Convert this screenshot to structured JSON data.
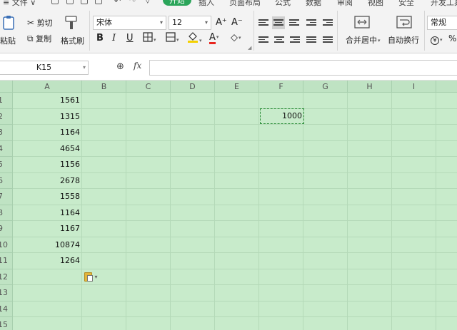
{
  "menu": {
    "file": "≡ 文件",
    "file_arrow": "∨",
    "tabs": [
      "开始",
      "插入",
      "页面布局",
      "公式",
      "数据",
      "审阅",
      "视图",
      "安全",
      "开发工具"
    ],
    "active_tab": "开始"
  },
  "ribbon": {
    "paste": "粘贴",
    "cut": "剪切",
    "copy": "复制",
    "format_painter": "格式刷",
    "font_name": "宋体",
    "font_size": "12",
    "grow_font": "A⁺",
    "shrink_font": "A⁻",
    "bold": "B",
    "italic": "I",
    "underline": "U",
    "font_color_letter": "A",
    "merge_center": "合并居中",
    "wrap_text": "自动换行",
    "number_format": "常规",
    "currency": "¥",
    "percent": "%",
    "colors": {
      "fill_yellow": "#f4d000",
      "font_red": "#e8261f",
      "accent_green": "#2ba55a"
    }
  },
  "formula_bar": {
    "name_box": "K15",
    "fx": "fx",
    "value": ""
  },
  "grid": {
    "columns": [
      "A",
      "B",
      "C",
      "D",
      "E",
      "F",
      "G",
      "H",
      "I"
    ],
    "rows": [
      "1",
      "2",
      "3",
      "4",
      "5",
      "6",
      "7",
      "8",
      "9",
      "10",
      "11",
      "12",
      "13",
      "14",
      "15"
    ],
    "column_a_values": [
      "1561",
      "1315",
      "1164",
      "4654",
      "1156",
      "2678",
      "1558",
      "1164",
      "1167",
      "10874",
      "1264"
    ],
    "f2_value": "1000",
    "paste_options_arrow": "▾",
    "background": "#c8ebcb"
  }
}
